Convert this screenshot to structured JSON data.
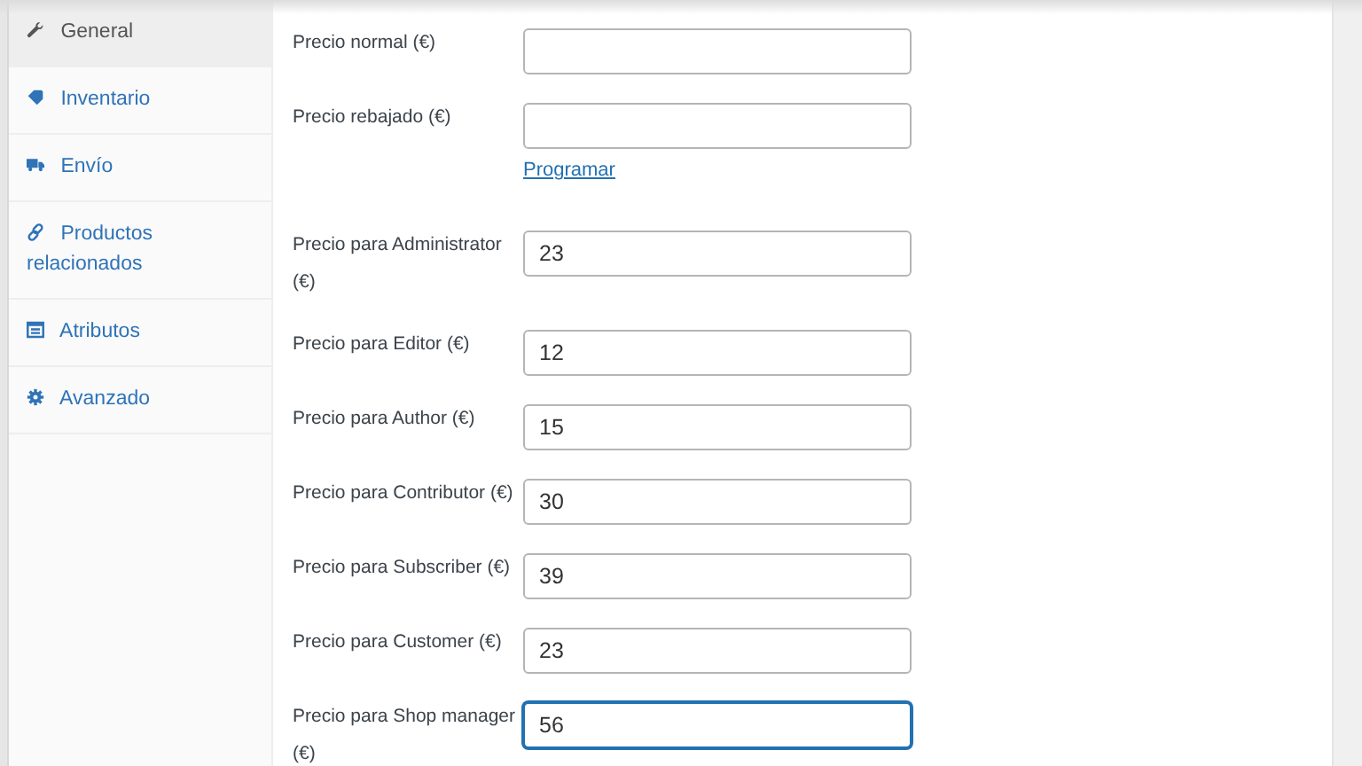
{
  "tabs": [
    {
      "label": "General",
      "selected": true
    },
    {
      "label": "Inventario",
      "selected": false
    },
    {
      "label": "Envío",
      "selected": false
    },
    {
      "label": "Productos relacionados",
      "selected": false
    },
    {
      "label": "Atributos",
      "selected": false
    },
    {
      "label": "Avanzado",
      "selected": false
    }
  ],
  "fields": [
    {
      "label": "Precio normal (€)",
      "focused": false
    },
    {
      "label": "Precio rebajado (€)",
      "focused": false,
      "link": "Programar"
    },
    {
      "label": "Precio para Administrator (€)",
      "value": "23",
      "focused": false
    },
    {
      "label": "Precio para Editor (€)",
      "value": "12",
      "focused": false
    },
    {
      "label": "Precio para Author (€)",
      "value": "15",
      "focused": false
    },
    {
      "label": "Precio para Contributor (€)",
      "value": "30",
      "focused": false
    },
    {
      "label": "Precio para Subscriber (€)",
      "value": "39",
      "focused": false
    },
    {
      "label": "Precio para Customer (€)",
      "value": "23",
      "focused": false
    },
    {
      "label": "Precio para Shop manager (€)",
      "value": "56",
      "focused": true
    }
  ]
}
